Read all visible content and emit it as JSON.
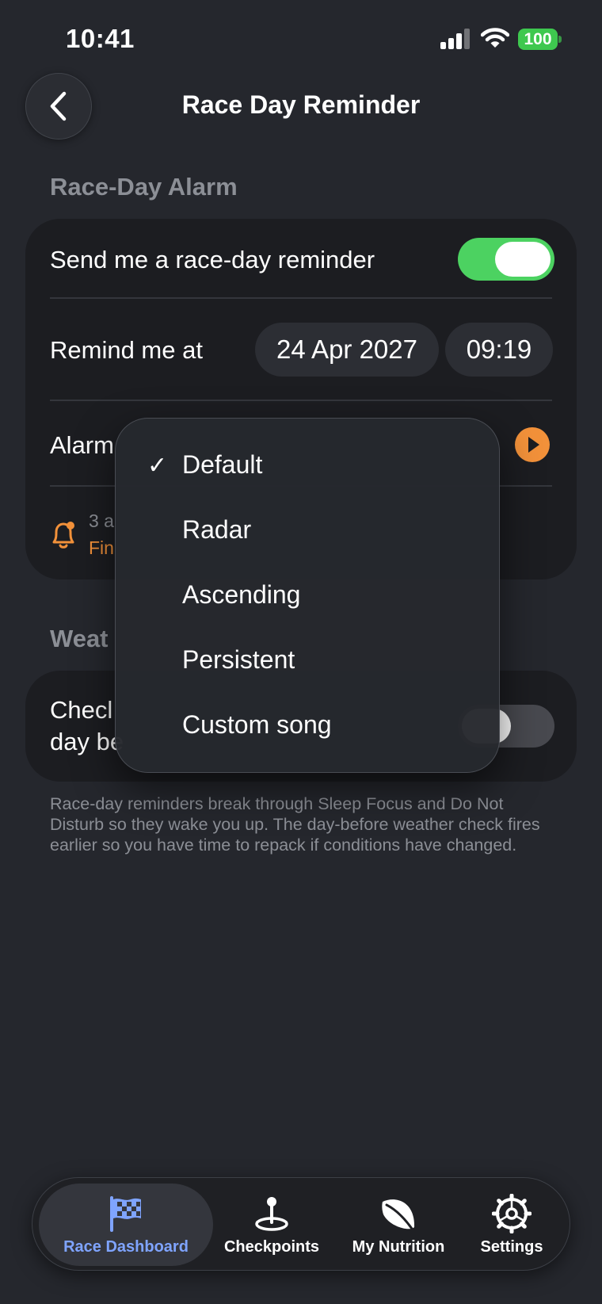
{
  "status_bar": {
    "time": "10:41",
    "battery": "100"
  },
  "header": {
    "title": "Race Day Reminder"
  },
  "race_day_alarm": {
    "section_title": "Race-Day Alarm",
    "reminder_label": "Send me a race-day reminder",
    "reminder_enabled": true,
    "remind_label": "Remind me at",
    "date_value": "24 Apr 2027",
    "time_value": "09:19",
    "alarm_label_visible": "Alarm",
    "info_text_visible": "3 a",
    "info_sub_visible": "Fin"
  },
  "weather": {
    "section_title_visible": "Weat",
    "check_line1_visible": "Checl",
    "check_line2_visible": "day be",
    "check_enabled": false
  },
  "footnote": "Race-day reminders break through Sleep Focus and Do Not Disturb so they wake you up. The day-before weather check fires earlier so you have time to repack if conditions have changed.",
  "dropdown": {
    "selected": "Default",
    "check_glyph": "✓",
    "options": [
      "Default",
      "Radar",
      "Ascending",
      "Persistent",
      "Custom song"
    ]
  },
  "tab_bar": {
    "tabs": [
      {
        "label": "Race Dashboard",
        "icon": "checkered-flag-icon",
        "active": true
      },
      {
        "label": "Checkpoints",
        "icon": "map-pin-icon",
        "active": false
      },
      {
        "label": "My Nutrition",
        "icon": "leaf-icon",
        "active": false
      },
      {
        "label": "Settings",
        "icon": "gear-icon",
        "active": false
      }
    ]
  },
  "colors": {
    "background": "#25272d",
    "card": "#1c1d21",
    "toggle_on": "#4cd261",
    "accent_orange": "#f2913a",
    "tab_active": "#7fa4ff",
    "secondary_text": "#8c8f96"
  }
}
